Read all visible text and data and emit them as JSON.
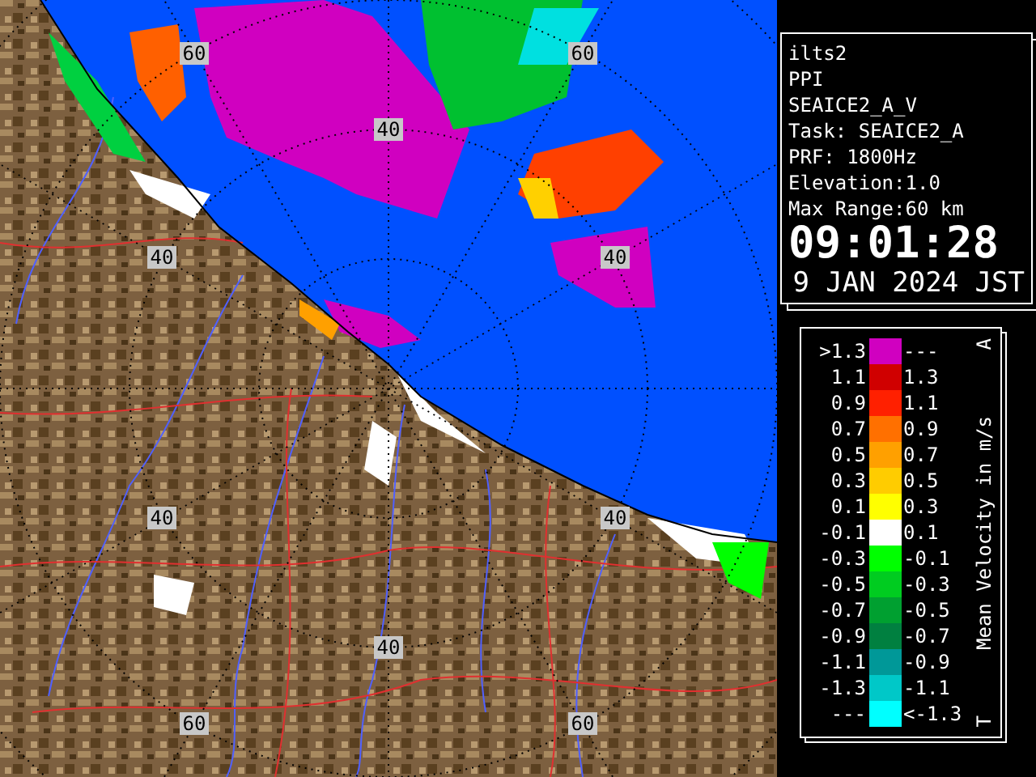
{
  "map": {
    "range_labels": [
      "60",
      "60",
      "40",
      "40",
      "40",
      "40",
      "40",
      "40",
      "60",
      "60"
    ]
  },
  "info": {
    "lines": [
      "ilts2",
      "PPI",
      "SEAICE2_A_V",
      "Task: SEAICE2_A",
      "PRF: 1800Hz",
      "Elevation:1.0",
      "Max Range:60 km"
    ],
    "time": "09:01:28",
    "date": "9 JAN 2024 JST"
  },
  "legend": {
    "title": "Mean Velocity in m/s",
    "top_mark": "A",
    "bottom_mark": "T",
    "rows": [
      {
        "low": ">1.3",
        "high": "---",
        "color": "#d000c0"
      },
      {
        "low": "1.1",
        "high": "1.3",
        "color": "#d00000"
      },
      {
        "low": "0.9",
        "high": "1.1",
        "color": "#ff2000"
      },
      {
        "low": "0.7",
        "high": "0.9",
        "color": "#ff7000"
      },
      {
        "low": "0.5",
        "high": "0.7",
        "color": "#ffa000"
      },
      {
        "low": "0.3",
        "high": "0.5",
        "color": "#ffcc00"
      },
      {
        "low": "0.1",
        "high": "0.3",
        "color": "#ffff00"
      },
      {
        "low": "-0.1",
        "high": "0.1",
        "color": "#ffffff"
      },
      {
        "low": "-0.3",
        "high": "-0.1",
        "color": "#00ff00"
      },
      {
        "low": "-0.5",
        "high": "-0.3",
        "color": "#00cc20"
      },
      {
        "low": "-0.7",
        "high": "-0.5",
        "color": "#00a030"
      },
      {
        "low": "-0.9",
        "high": "-0.7",
        "color": "#008040"
      },
      {
        "low": "-1.1",
        "high": "-0.9",
        "color": "#009898"
      },
      {
        "low": "-1.3",
        "high": "-1.1",
        "color": "#00c8c8"
      },
      {
        "low": "---",
        "high": "<-1.3",
        "color": "#00ffff"
      }
    ]
  }
}
